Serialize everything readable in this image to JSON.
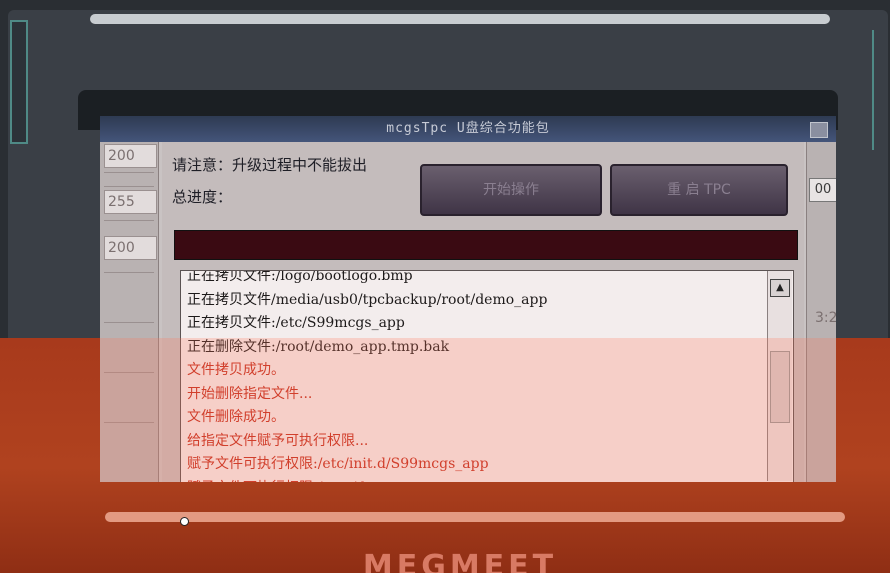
{
  "window": {
    "title": "mcgsTpc U盘综合功能包"
  },
  "side_left": {
    "values": [
      "200",
      "255",
      "200"
    ]
  },
  "side_right": {
    "value": "00",
    "time_fragment": "3:2"
  },
  "dialog": {
    "notice": "请注意：升级过程中不能拔出",
    "progress_label": "总进度：",
    "start_button": "开始操作",
    "reboot_button": "重 启 TPC",
    "progress": 1.0
  },
  "log": {
    "lines": [
      {
        "text": "正在拷贝文件:/logo/bootlogo.bmp",
        "style": "dark"
      },
      {
        "text": "正在拷贝文件/media/usb0/tpcbackup/root/demo_app",
        "style": "dark"
      },
      {
        "text": "正在拷贝文件:/etc/S99mcgs_app",
        "style": "dark"
      },
      {
        "text": "正在删除文件:/root/demo_app.tmp.bak",
        "style": "dark"
      },
      {
        "text": "文件拷贝成功。",
        "style": "red"
      },
      {
        "text": "开始删除指定文件...",
        "style": "red"
      },
      {
        "text": "文件删除成功。",
        "style": "red"
      },
      {
        "text": "给指定文件赋予可执行权限...",
        "style": "red"
      },
      {
        "text": "赋予文件可执行权限:/etc/init.d/S99mcgs_app",
        "style": "red"
      },
      {
        "text": "赋予文件可执行权限:/root/demo_app",
        "style": "red"
      }
    ]
  },
  "brand": {
    "text": "MEGMEET"
  },
  "icons": {
    "scroll_up": "arrow-up-icon",
    "cursor": "mouse-pointer-icon"
  }
}
